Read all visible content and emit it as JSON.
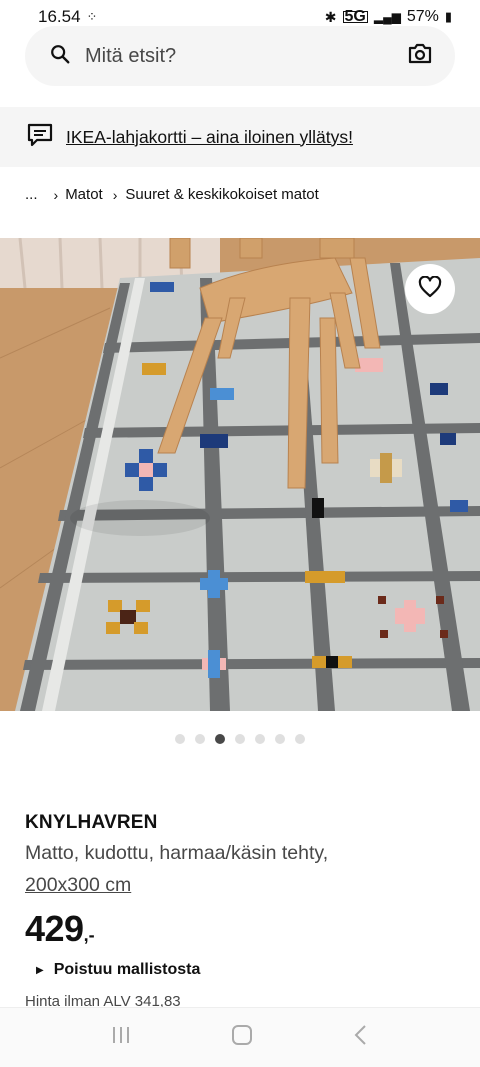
{
  "status_bar": {
    "time": "16.54",
    "battery": "57%",
    "network": "5G"
  },
  "search": {
    "placeholder": "Mitä etsit?",
    "search_icon": "search-icon",
    "camera_icon": "camera-icon"
  },
  "promo": {
    "icon": "chat-bubble-icon",
    "text": "IKEA-lahjakortti – aina iloinen yllätys!"
  },
  "breadcrumb": {
    "ellipsis": "...",
    "items": [
      "Matot",
      "Suuret & keskikokoiset matot"
    ]
  },
  "gallery": {
    "total": 7,
    "active_index": 2,
    "favourite_icon": "heart-icon"
  },
  "product": {
    "name": "KNYLHAVREN",
    "description": "Matto, kudottu, harmaa/käsin tehty,",
    "size": "200x300 cm",
    "price_integer": "429",
    "price_decimal": ",-",
    "discontinued": "Poistuu mallistosta",
    "vat_text": "Hinta ilman ALV 341,83"
  },
  "colors": {
    "accent": "#111111",
    "promo_bg": "#f5f5f5"
  }
}
